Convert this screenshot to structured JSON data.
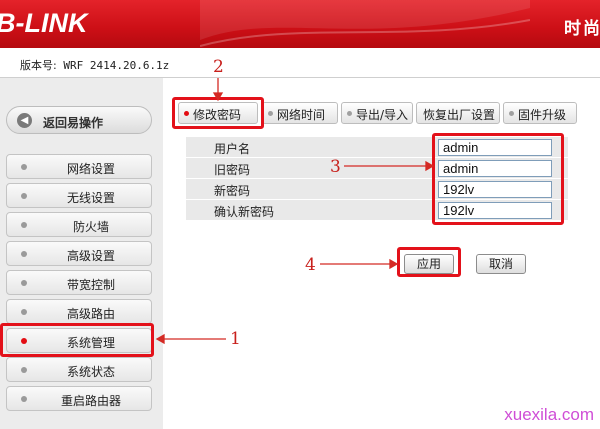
{
  "header": {
    "logo": "B-LINK",
    "right_text": "时尚"
  },
  "version": {
    "label": "版本号:",
    "value": "WRF 2414.20.6.1z"
  },
  "sidebar": {
    "back": {
      "label": "返回易操作"
    },
    "items": [
      {
        "label": "网络设置"
      },
      {
        "label": "无线设置"
      },
      {
        "label": "防火墙"
      },
      {
        "label": "高级设置"
      },
      {
        "label": "带宽控制"
      },
      {
        "label": "高级路由"
      },
      {
        "label": "系统管理",
        "active": true
      },
      {
        "label": "系统状态"
      },
      {
        "label": "重启路由器"
      }
    ]
  },
  "tabs": [
    {
      "label": "修改密码",
      "active": true
    },
    {
      "label": "网络时间"
    },
    {
      "label": "导出/导入"
    },
    {
      "label": "恢复出厂设置"
    },
    {
      "label": "固件升级"
    }
  ],
  "form": {
    "rows": [
      {
        "label": "用户名",
        "value": "admin"
      },
      {
        "label": "旧密码",
        "value": "admin"
      },
      {
        "label": "新密码",
        "value": "192lv"
      },
      {
        "label": "确认新密码",
        "value": "192lv"
      }
    ],
    "apply_label": "应用",
    "cancel_label": "取消"
  },
  "annotations": {
    "n1": "1",
    "n2": "2",
    "n3": "3",
    "n4": "4"
  },
  "watermark": "xuexila.com",
  "colors": {
    "brand_red": "#d4161c",
    "annotation_red": "#e3111a",
    "sidebar_bg": "#ececec"
  }
}
